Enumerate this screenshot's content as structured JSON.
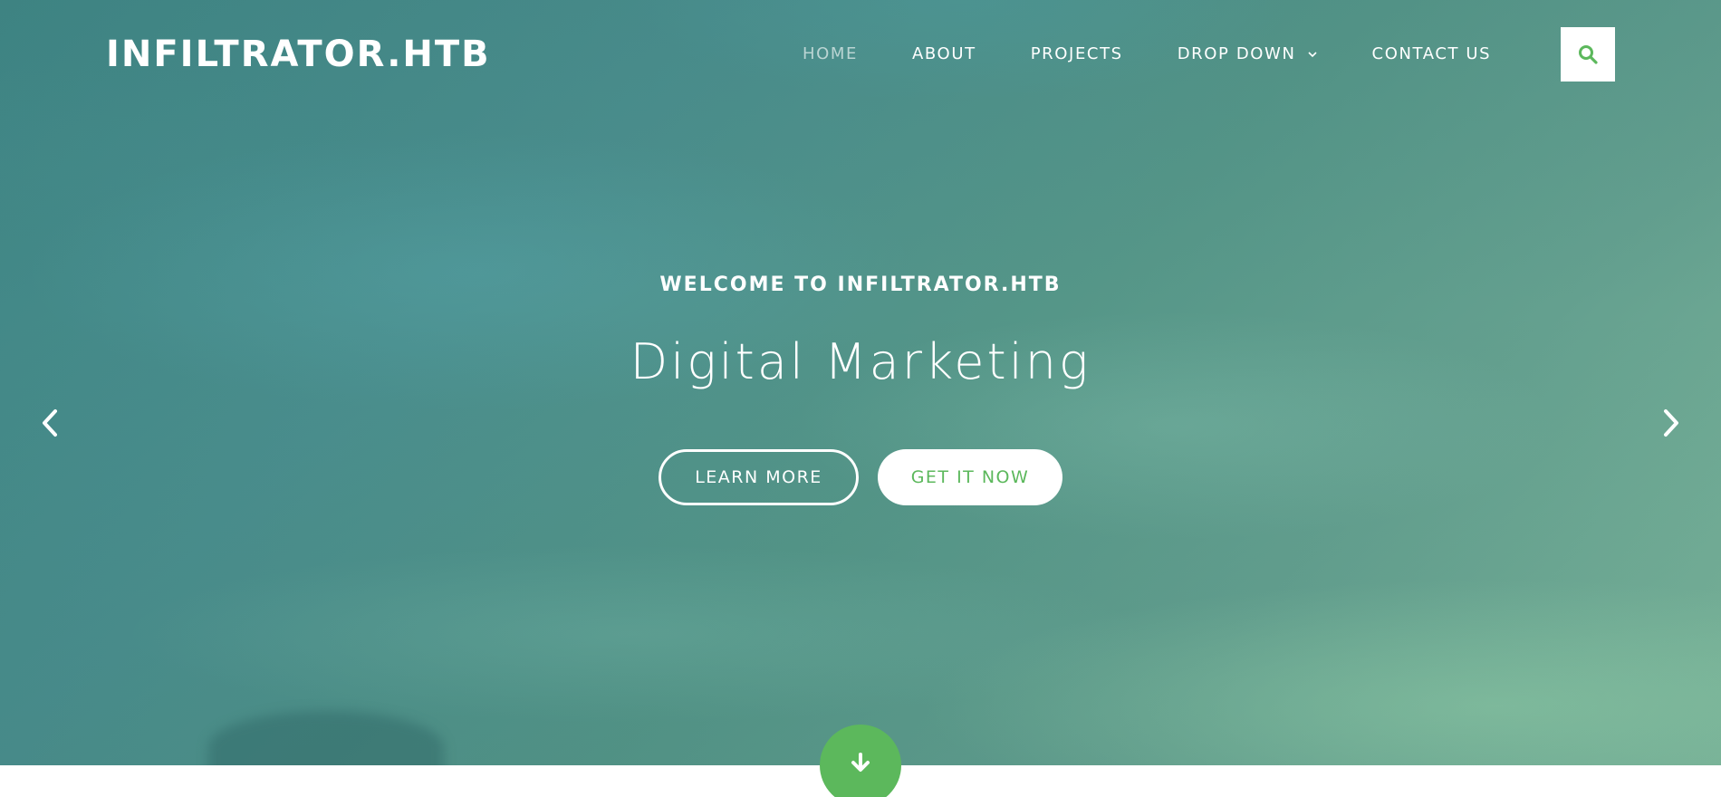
{
  "site": {
    "logo": "INFILTRATOR.HTB"
  },
  "nav": {
    "items": [
      {
        "label": "HOME",
        "active": true
      },
      {
        "label": "ABOUT"
      },
      {
        "label": "PROJECTS"
      },
      {
        "label": "DROP DOWN",
        "has_dropdown": true
      },
      {
        "label": "CONTACT US"
      }
    ],
    "search_icon": "search-icon"
  },
  "hero": {
    "welcome": "WELCOME TO INFILTRATOR.HTB",
    "headline": "Digital Marketing",
    "learn_more": "LEARN MORE",
    "get_it_now": "GET IT NOW",
    "prev_icon": "chevron-left-icon",
    "next_icon": "chevron-right-icon",
    "scroll_icon": "arrow-down-icon"
  },
  "colors": {
    "accent": "#5cb85c",
    "text_light": "#ffffff",
    "hero_bg": "#4a8e8d"
  }
}
